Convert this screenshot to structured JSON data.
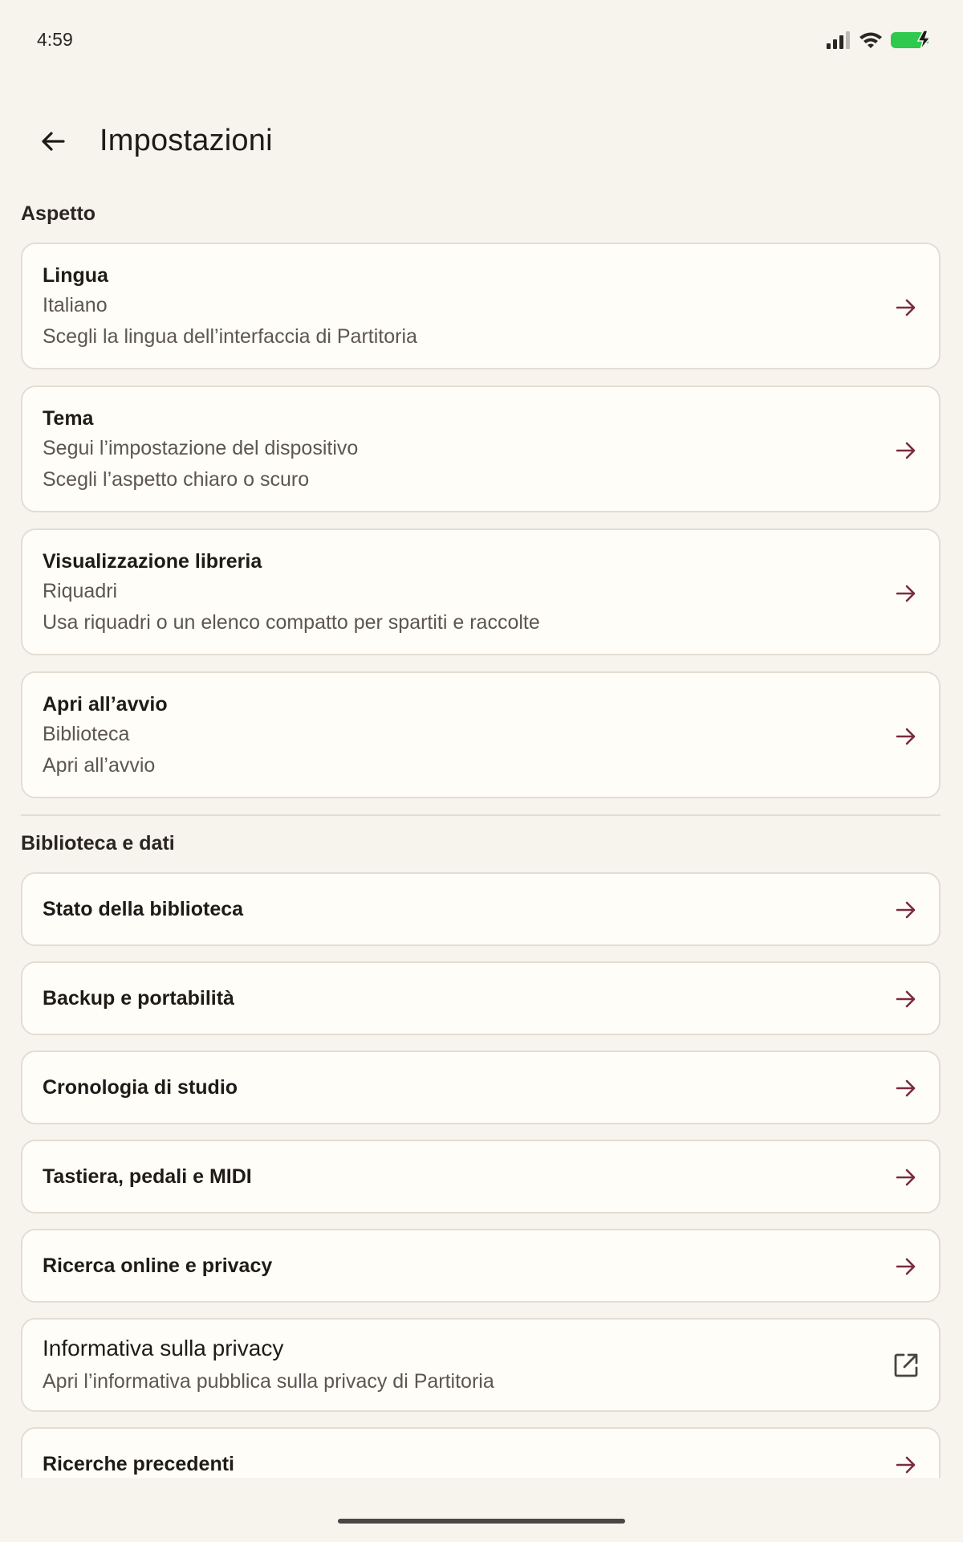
{
  "status_bar": {
    "time": "4:59",
    "icons": [
      "signal-icon",
      "wifi-icon",
      "battery-charging-icon"
    ]
  },
  "app_bar": {
    "title": "Impostazioni",
    "back_icon": "arrow-left-icon"
  },
  "sections": {
    "appearance": {
      "header": "Aspetto",
      "items": [
        {
          "title": "Lingua",
          "value": "Italiano",
          "description": "Scegli la lingua dell’interfaccia di Partitoria"
        },
        {
          "title": "Tema",
          "value": "Segui l’impostazione del dispositivo",
          "description": "Scegli l’aspetto chiaro o scuro"
        },
        {
          "title": "Visualizzazione libreria",
          "value": "Riquadri",
          "description": "Usa riquadri o un elenco compatto per spartiti e raccolte"
        },
        {
          "title": "Apri all’avvio",
          "value": "Biblioteca",
          "description": "Apri all’avvio"
        }
      ]
    },
    "library": {
      "header": "Biblioteca e dati",
      "items": [
        {
          "title": "Stato della biblioteca"
        },
        {
          "title": "Backup e portabilità"
        },
        {
          "title": "Cronologia di studio"
        },
        {
          "title": "Tastiera, pedali e MIDI"
        },
        {
          "title": "Ricerca online e privacy"
        },
        {
          "title": "Informativa sulla privacy",
          "description": "Apri l’informativa pubblica sulla privacy di Partitoria",
          "icon": "external-link-icon"
        },
        {
          "title": "Ricerche precedenti"
        }
      ]
    }
  },
  "colors": {
    "background": "#f7f4ed",
    "card": "#fffdf8",
    "border": "#e3ddd4",
    "accent_arrow": "#7a2b3f",
    "battery": "#2fc94e"
  }
}
